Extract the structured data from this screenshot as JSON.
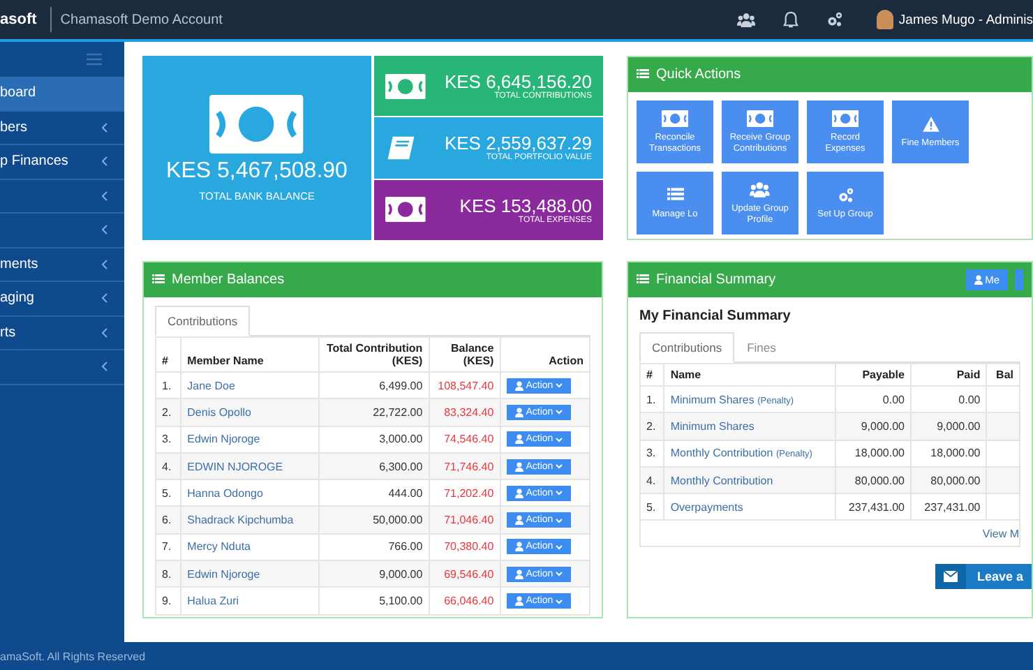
{
  "topbar": {
    "logo": "asoft",
    "account": "Chamasoft Demo Account",
    "user": "James Mugo - Adminis"
  },
  "sidebar": {
    "items": [
      {
        "label": "board",
        "selected": true
      },
      {
        "label": "bers",
        "selected": false
      },
      {
        "label": "p Finances",
        "selected": false
      },
      {
        "selected": false
      },
      {
        "selected": false
      },
      {
        "label": "ments",
        "selected": false
      },
      {
        "label": "aging",
        "selected": false
      },
      {
        "label": "rts",
        "selected": false
      },
      {
        "selected": false
      }
    ]
  },
  "stats": [
    {
      "kind": "money",
      "value": "KES 5,467,508.90",
      "label": "TOTAL BANK BALANCE",
      "color": "#29a8e0"
    },
    {
      "kind": "money",
      "value": "KES 6,645,156.20",
      "label": "TOTAL CONTRIBUTIONS",
      "color": "#27b677"
    },
    {
      "kind": "book",
      "value": "KES 2,559,637.29",
      "label": "TOTAL PORTFOLIO VALUE",
      "color": "#29a8e0"
    },
    {
      "kind": "money",
      "value": "KES 153,488.00",
      "label": "TOTAL EXPENSES",
      "color": "#8b2a9c"
    }
  ],
  "quick_actions": {
    "title": "Quick Actions",
    "items": [
      {
        "kind": "money",
        "label": "Reconcile Transactions"
      },
      {
        "kind": "money",
        "label": "Receive Group Contributions"
      },
      {
        "kind": "money",
        "label": "Record Expenses"
      },
      {
        "kind": "warning",
        "label": "Fine Members"
      },
      {
        "kind": "list",
        "label": "Manage Lo"
      },
      {
        "kind": "users",
        "label": "Update Group Profile"
      },
      {
        "kind": "gears",
        "label": "Set Up Group"
      }
    ]
  },
  "member_balances": {
    "title": "Member Balances",
    "tabs": [
      {
        "label": "Contributions",
        "selected": true
      }
    ],
    "columns": [
      "#",
      "Member Name",
      "Total Contribution (KES)",
      "Balance (KES)",
      "Action"
    ],
    "rows": [
      {
        "num": "1.",
        "name": "Jane Doe",
        "total": "6,499.00",
        "balance": "108,547.40",
        "action": "Action"
      },
      {
        "num": "2.",
        "name": "Denis Opollo",
        "total": "22,722.00",
        "balance": "83,324.40",
        "action": "Action"
      },
      {
        "num": "3.",
        "name": "Edwin Njoroge",
        "total": "3,000.00",
        "balance": "74,546.40",
        "action": "Action"
      },
      {
        "num": "4.",
        "name": "EDWIN NJOROGE",
        "total": "6,300.00",
        "balance": "71,746.40",
        "action": "Action"
      },
      {
        "num": "5.",
        "name": "Hanna Odongo",
        "total": "444.00",
        "balance": "71,202.40",
        "action": "Action"
      },
      {
        "num": "6.",
        "name": "Shadrack Kipchumba",
        "total": "50,000.00",
        "balance": "71,046.40",
        "action": "Action"
      },
      {
        "num": "7.",
        "name": "Mercy Nduta",
        "total": "766.00",
        "balance": "70,380.40",
        "action": "Action"
      },
      {
        "num": "8.",
        "name": "Edwin Njoroge",
        "total": "9,000.00",
        "balance": "69,546.40",
        "action": "Action"
      },
      {
        "num": "9.",
        "name": "Halua Zuri",
        "total": "5,100.00",
        "balance": "66,046.40",
        "action": "Action"
      }
    ]
  },
  "financial_summary": {
    "title": "Financial Summary",
    "me_button": "Me",
    "heading": "My Financial Summary",
    "tabs": [
      {
        "label": "Contributions",
        "selected": true
      },
      {
        "label": "Fines",
        "selected": false
      }
    ],
    "columns": [
      "#",
      "Name",
      "Payable",
      "Paid",
      "Bal"
    ],
    "rows": [
      {
        "num": "1.",
        "name": "Minimum Shares",
        "note": "(Penalty)",
        "payable": "0.00",
        "paid": "0.00"
      },
      {
        "num": "2.",
        "name": "Minimum Shares",
        "payable": "9,000.00",
        "paid": "9,000.00"
      },
      {
        "num": "3.",
        "name": "Monthly Contribution",
        "note": "(Penalty)",
        "payable": "18,000.00",
        "paid": "18,000.00"
      },
      {
        "num": "4.",
        "name": "Monthly Contribution",
        "payable": "80,000.00",
        "paid": "80,000.00"
      },
      {
        "num": "5.",
        "name": "Overpayments",
        "payable": "237,431.00",
        "paid": "237,431.00"
      }
    ],
    "view_more": "View M",
    "message_button": "Leave a"
  },
  "footer": "amaSoft. All Rights Reserved"
}
